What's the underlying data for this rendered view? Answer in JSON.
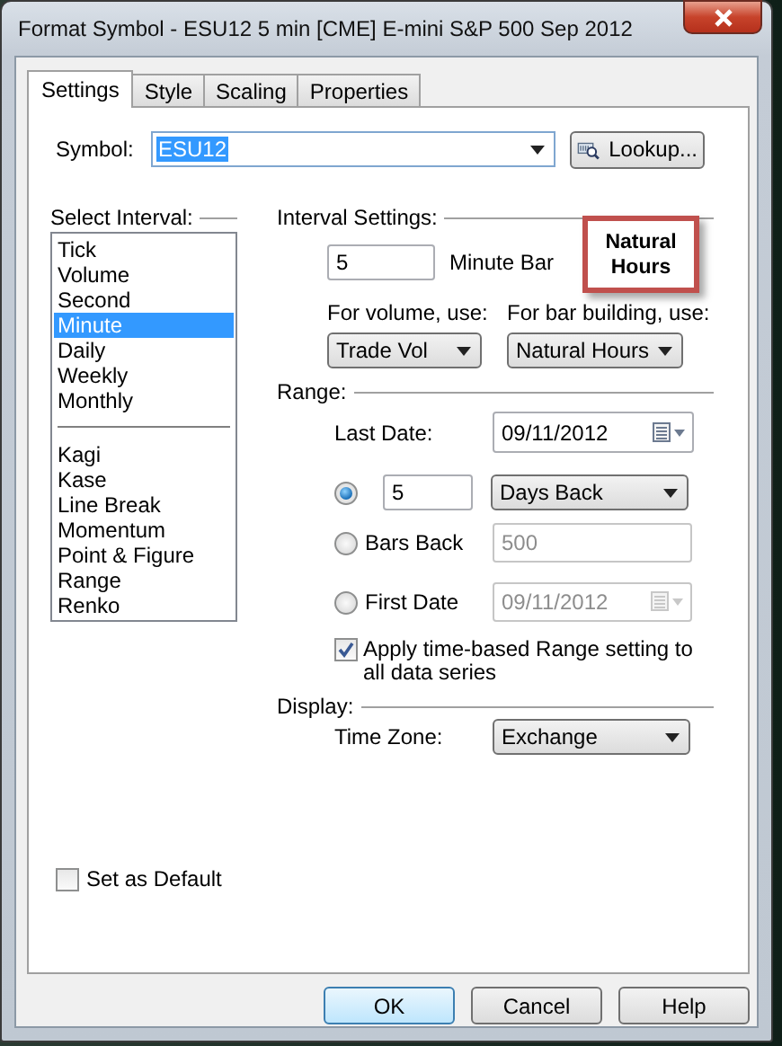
{
  "window": {
    "title": "Format Symbol - ESU12 5 min [CME] E-mini S&P 500 Sep 2012"
  },
  "tabs": [
    {
      "label": "Settings",
      "selected": true
    },
    {
      "label": "Style",
      "selected": false
    },
    {
      "label": "Scaling",
      "selected": false
    },
    {
      "label": "Properties",
      "selected": false
    }
  ],
  "symbol": {
    "label": "Symbol:",
    "value": "ESU12",
    "lookup_button": "Lookup..."
  },
  "interval_list": {
    "heading": "Select Interval:",
    "groups": [
      [
        {
          "label": "Tick",
          "selected": false
        },
        {
          "label": "Volume",
          "selected": false
        },
        {
          "label": "Second",
          "selected": false
        },
        {
          "label": "Minute",
          "selected": true
        },
        {
          "label": "Daily",
          "selected": false
        },
        {
          "label": "Weekly",
          "selected": false
        },
        {
          "label": "Monthly",
          "selected": false
        }
      ],
      [
        {
          "label": "Kagi",
          "selected": false
        },
        {
          "label": "Kase",
          "selected": false
        },
        {
          "label": "Line Break",
          "selected": false
        },
        {
          "label": "Momentum",
          "selected": false
        },
        {
          "label": "Point & Figure",
          "selected": false
        },
        {
          "label": "Range",
          "selected": false
        },
        {
          "label": "Renko",
          "selected": false
        }
      ]
    ]
  },
  "interval_settings": {
    "heading": "Interval Settings:",
    "value": "5",
    "unit": "Minute Bar",
    "callout": "Natural Hours",
    "volume_label": "For volume, use:",
    "volume_value": "Trade Vol",
    "bar_building_label": "For bar building, use:",
    "bar_building_value": "Natural Hours"
  },
  "range": {
    "heading": "Range:",
    "last_date_label": "Last Date:",
    "last_date": "09/11/2012",
    "options": [
      {
        "kind": "count",
        "selected": true,
        "disabled": false,
        "value": "5",
        "unit": "Days Back"
      },
      {
        "kind": "bars",
        "selected": false,
        "disabled": true,
        "label": "Bars Back",
        "value": "500"
      },
      {
        "kind": "date",
        "selected": false,
        "disabled": true,
        "label": "First Date",
        "value": "09/11/2012"
      }
    ],
    "apply_all": {
      "label": "Apply time-based Range setting to all data series",
      "checked": true
    }
  },
  "display": {
    "heading": "Display:",
    "time_zone_label": "Time Zone:",
    "time_zone": "Exchange"
  },
  "set_default": {
    "label": "Set as Default",
    "checked": false
  },
  "buttons": [
    {
      "label": "OK",
      "default": true
    },
    {
      "label": "Cancel",
      "default": false
    },
    {
      "label": "Help",
      "default": false
    }
  ]
}
